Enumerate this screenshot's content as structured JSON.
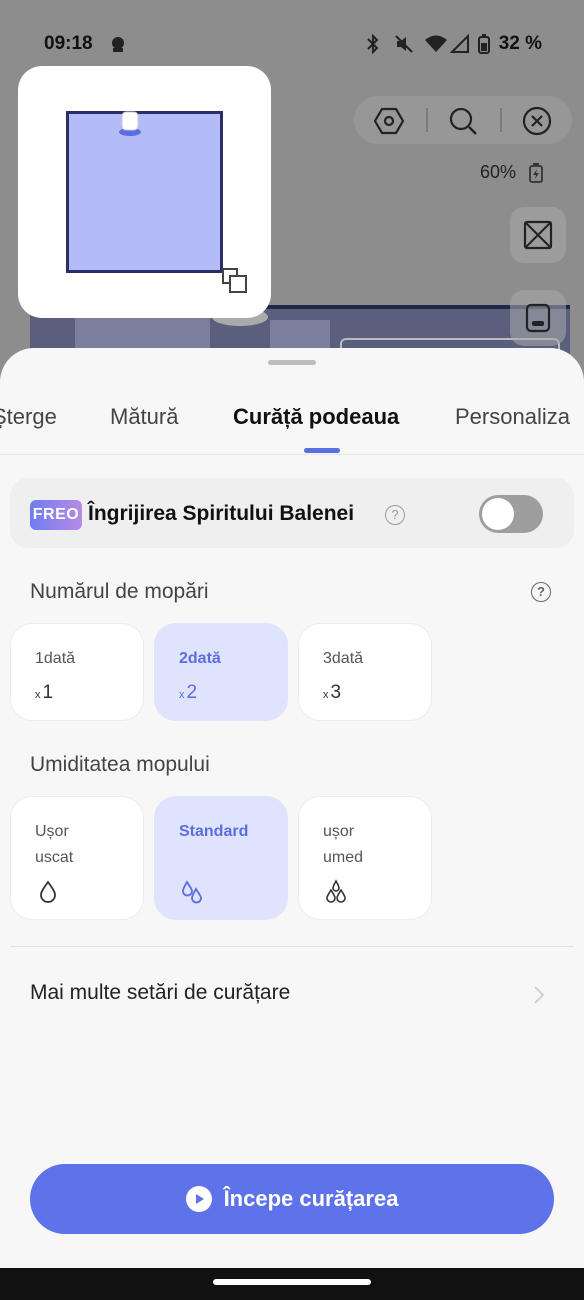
{
  "status_bar": {
    "time": "09:18",
    "battery": "32 %"
  },
  "toolbar": {
    "battery_level": "60%"
  },
  "sheet": {
    "tabs": [
      {
        "label": "Şterge"
      },
      {
        "label": "Mătură"
      },
      {
        "label": "Curăță podeaua"
      },
      {
        "label": "Personaliza"
      }
    ],
    "active_tab": "Curăță podeaua",
    "care": {
      "badge": "FREO",
      "label": "Îngrijirea Spiritului Balenei",
      "help": "?",
      "enabled": false
    },
    "mop_count": {
      "title": "Numărul de mopări",
      "help": "?",
      "options": [
        {
          "label": "1dată",
          "prefix": "x",
          "value": "1",
          "selected": false
        },
        {
          "label": "2dată",
          "prefix": "x",
          "value": "2",
          "selected": true
        },
        {
          "label": "3dată",
          "prefix": "x",
          "value": "3",
          "selected": false
        }
      ]
    },
    "humidity": {
      "title": "Umiditatea mopului",
      "options": [
        {
          "line1": "Ușor",
          "line2": "uscat",
          "icon": "drop-single-icon",
          "selected": false
        },
        {
          "line1": "Standard",
          "line2": "",
          "icon": "drop-double-icon",
          "selected": true
        },
        {
          "line1": "ușor",
          "line2": "umed",
          "icon": "drop-triple-icon",
          "selected": false
        }
      ]
    },
    "more_settings": "Mai multe setări de curățare",
    "start_button": "Începe curățarea"
  },
  "colors": {
    "accent": "#5e73e9",
    "selected_bg": "#dfe3fc",
    "room_fill": "#b3bcf6"
  }
}
